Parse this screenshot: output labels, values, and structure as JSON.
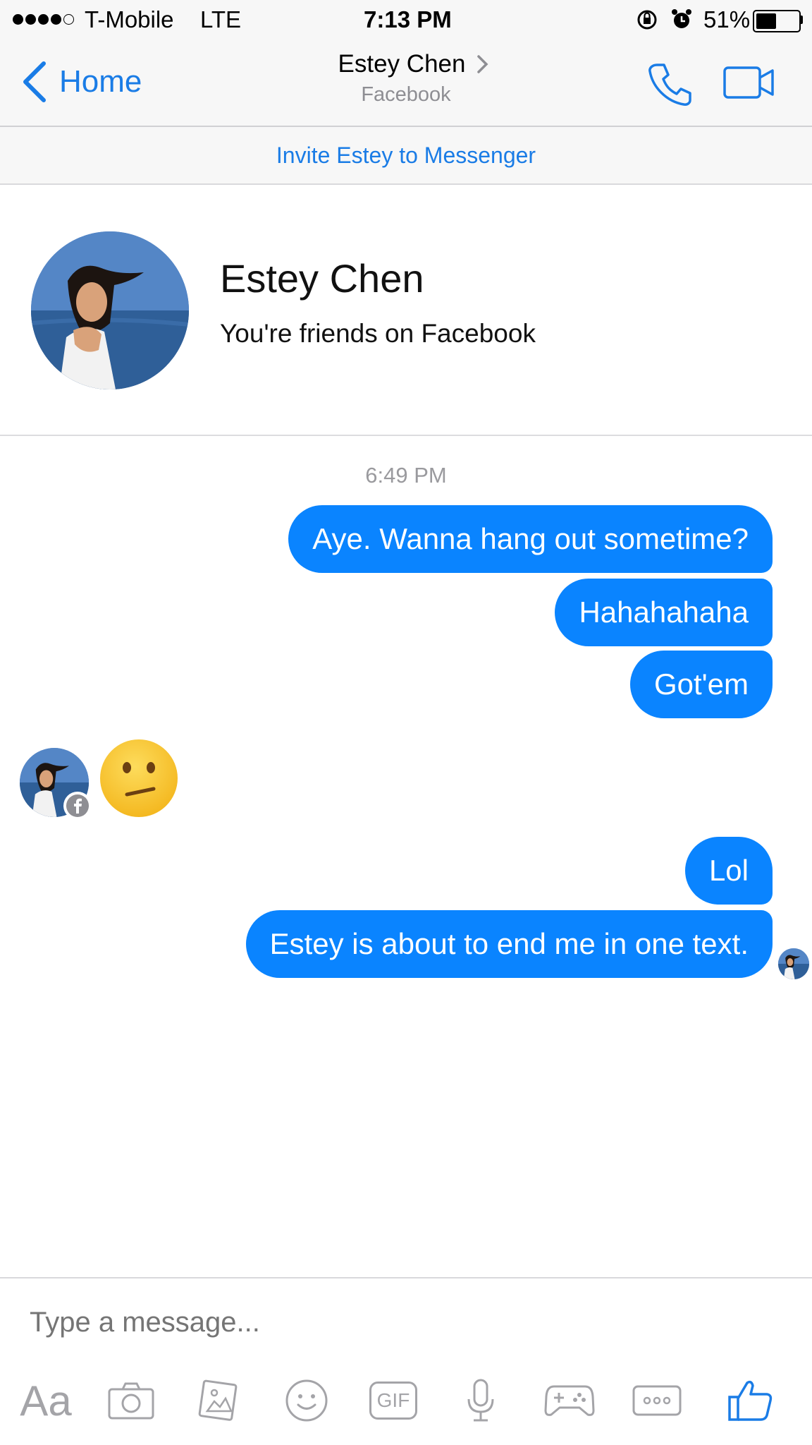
{
  "status_bar": {
    "carrier": "T-Mobile",
    "network": "LTE",
    "time": "7:13 PM",
    "battery_percent": "51%",
    "battery_level": 0.51,
    "signal_bars": 4
  },
  "nav": {
    "back_label": "Home",
    "contact_name": "Estey Chen",
    "contact_subtitle": "Facebook",
    "call_icon": "phone-icon",
    "video_icon": "video-camera-icon"
  },
  "invite": {
    "label": "Invite Estey to Messenger"
  },
  "profile": {
    "name": "Estey Chen",
    "status": "You're friends on Facebook"
  },
  "conversation": {
    "timestamp": "6:49 PM",
    "messages": [
      {
        "from": "me",
        "text": "Aye. Wanna hang out sometime?"
      },
      {
        "from": "me",
        "text": "Hahahahaha"
      },
      {
        "from": "me",
        "text": "Got'em"
      },
      {
        "from": "them",
        "type": "emoji",
        "emoji": "confused-face"
      },
      {
        "from": "me",
        "text": "Lol"
      },
      {
        "from": "me",
        "text": "Estey is about to end me in one text."
      }
    ]
  },
  "composer": {
    "placeholder": "Type a message...",
    "text_format_label": "Aa",
    "gif_label": "GIF"
  },
  "colors": {
    "accent": "#1a7ce6",
    "bubble": "#0a84ff",
    "bar_bg": "#f7f7f7",
    "emoji_yellow": "#f8c534"
  }
}
